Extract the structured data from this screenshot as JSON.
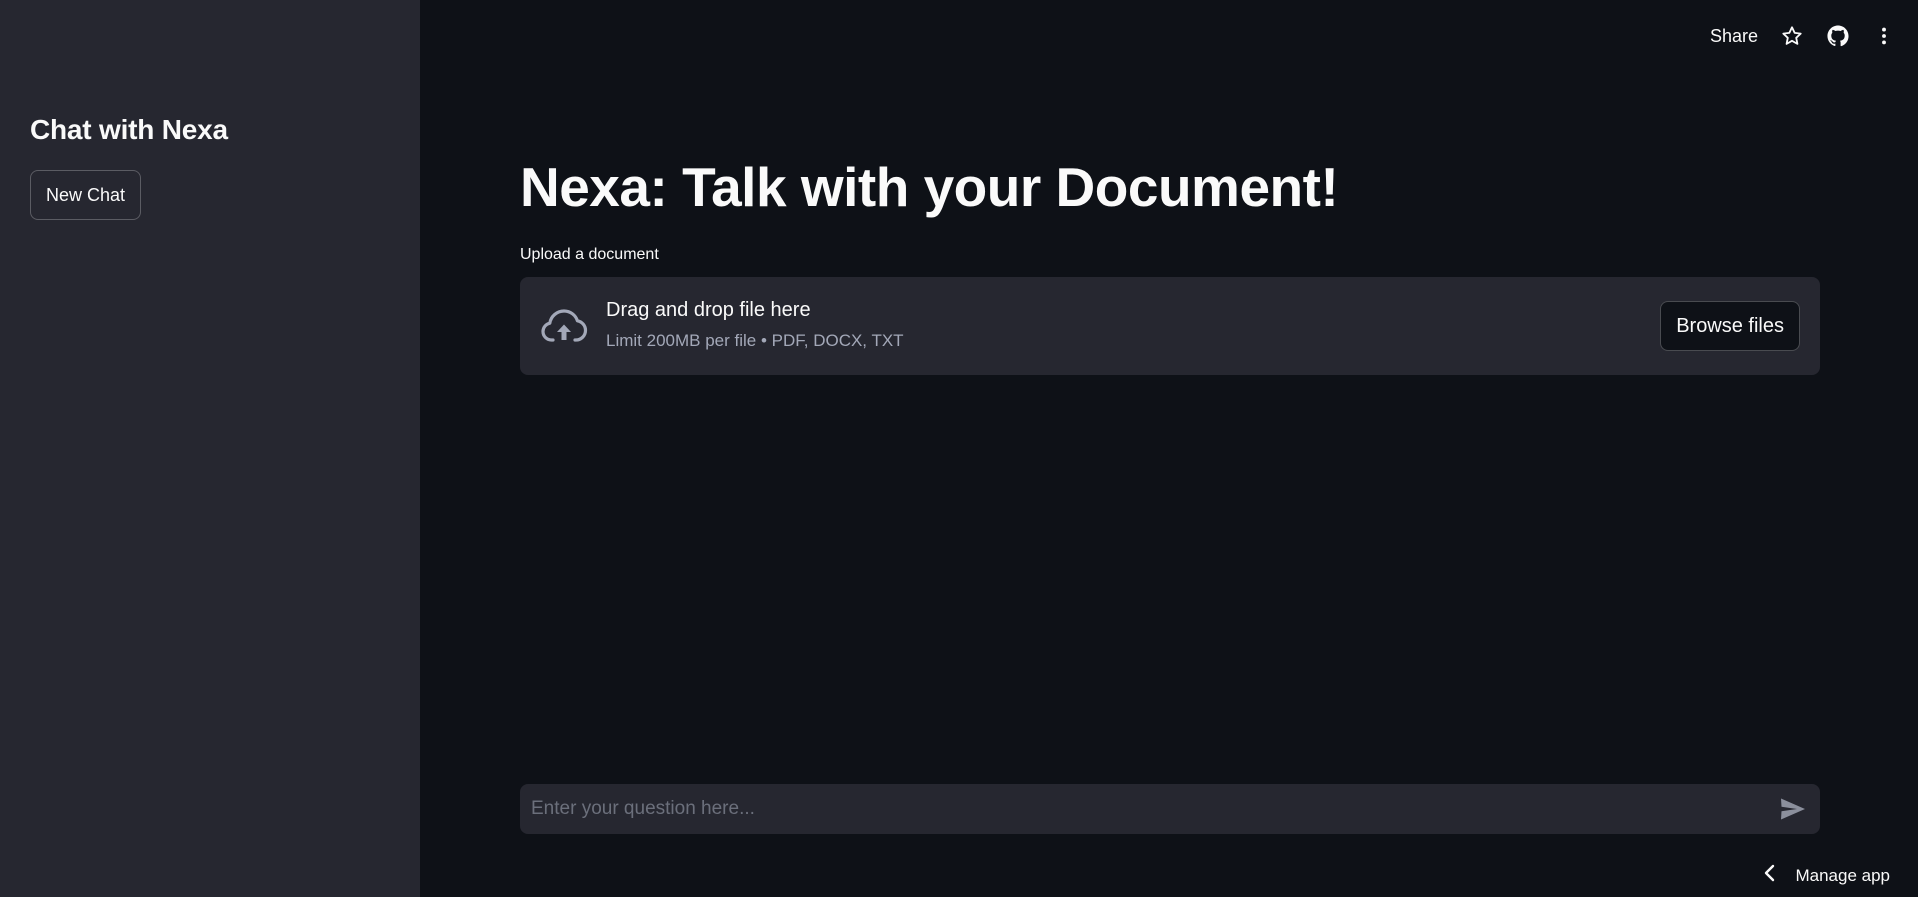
{
  "sidebar": {
    "title": "Chat with Nexa",
    "new_chat_label": "New Chat"
  },
  "header": {
    "share_label": "Share",
    "icons": [
      "star-icon",
      "github-icon",
      "more-vertical-icon"
    ]
  },
  "main": {
    "title": "Nexa: Talk with your Document!",
    "uploader": {
      "label": "Upload a document",
      "drop_text": "Drag and drop file here",
      "limit_text": "Limit 200MB per file • PDF, DOCX, TXT",
      "browse_label": "Browse files",
      "icon": "cloud-upload-icon"
    },
    "chat_input": {
      "value": "",
      "placeholder": "Enter your question here...",
      "send_icon": "send-icon"
    }
  },
  "footer": {
    "manage_label": "Manage app",
    "icon": "chevron-left-icon"
  },
  "colors": {
    "background": "#0e1117",
    "sidebar": "#262730",
    "text": "#fafafa",
    "muted_text": "#a3a8b8",
    "placeholder": "#6b6f7b"
  }
}
